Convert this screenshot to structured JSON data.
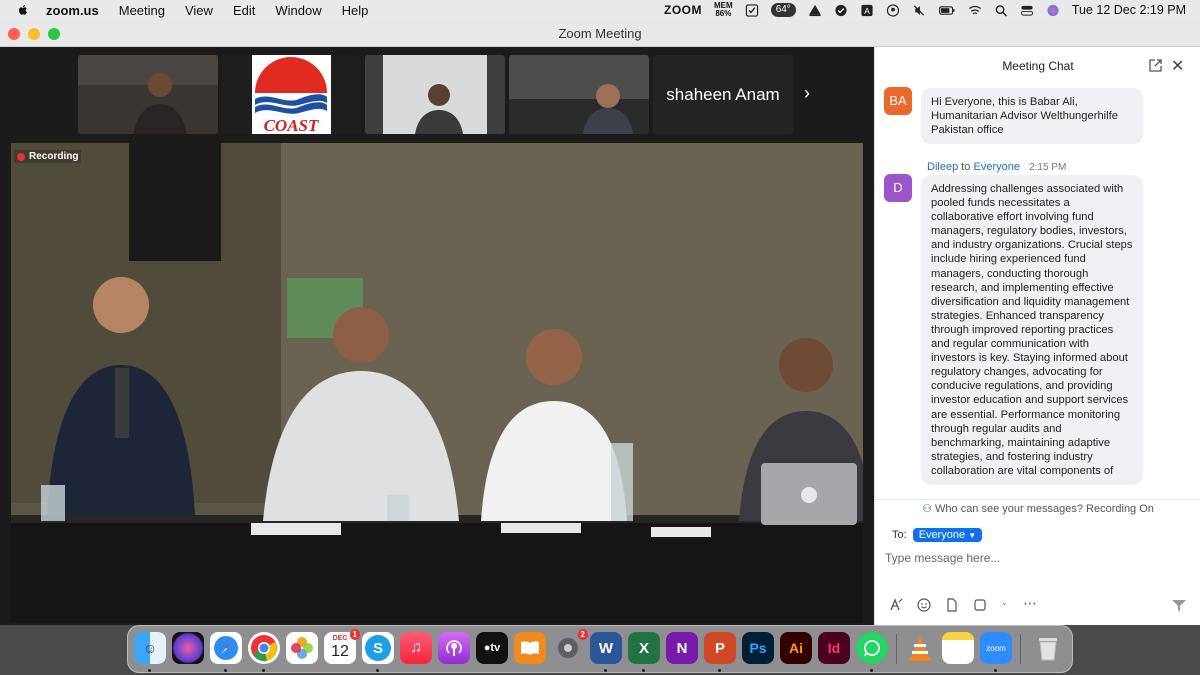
{
  "menubar": {
    "app_name": "zoom.us",
    "items": [
      "Meeting",
      "View",
      "Edit",
      "Window",
      "Help"
    ],
    "status": {
      "zoom_label": "ZOOM",
      "mem_label": "MEM",
      "mem_value": "86%",
      "temperature": "64°",
      "date_time": "Tue 12 Dec  2:19 PM"
    }
  },
  "window": {
    "title": "Zoom Meeting"
  },
  "meeting": {
    "name_tile": "shaheen Anam",
    "recording_label": "Recording",
    "logo_text": "COAST"
  },
  "chat": {
    "title": "Meeting Chat",
    "messages": [
      {
        "avatar_initials": "BA",
        "avatar_color": "#e8692a",
        "text": "Hi Everyone, this is Babar Ali, Humanitarian Advisor Welthungerhilfe Pakistan office"
      },
      {
        "avatar_initials": "D",
        "avatar_color": "#9b55c8",
        "sender": "Dileep",
        "to_word": "to",
        "recipient": "Everyone",
        "time": "2:15 PM",
        "text": "Addressing challenges associated with pooled funds necessitates a collaborative effort involving fund managers, regulatory bodies, investors, and industry organizations. Crucial steps include hiring experienced fund managers, conducting thorough research, and implementing effective diversification and liquidity management strategies. Enhanced transparency through improved reporting practices and regular communication with investors is key. Staying informed about regulatory changes, advocating for conducive regulations, and providing investor education and support services are essential. Performance monitoring through regular audits and benchmarking, maintaining adaptive strategies, and fostering industry collaboration are vital components of"
      }
    ],
    "privacy_notice": "Who can see your messages? Recording On",
    "to_label": "To:",
    "recipient_selector": "Everyone",
    "input_placeholder": "Type message here..."
  },
  "dock": {
    "calendar_month": "DEC",
    "calendar_day": "12",
    "calendar_badge": "1",
    "settings_badge": "2"
  }
}
